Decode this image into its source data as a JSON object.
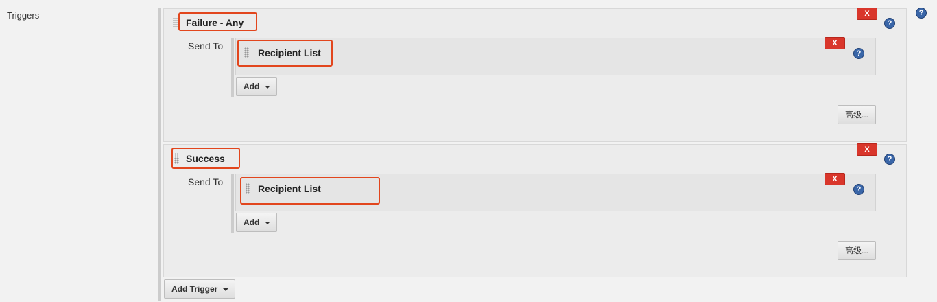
{
  "section": {
    "label": "Triggers"
  },
  "triggers": [
    {
      "title": "Failure - Any",
      "delete_label": "X",
      "send_to_label": "Send To",
      "recipients": [
        {
          "title": "Recipient List",
          "delete_label": "X"
        }
      ],
      "add_label": "Add",
      "advanced_label": "高级..."
    },
    {
      "title": "Success",
      "delete_label": "X",
      "send_to_label": "Send To",
      "recipients": [
        {
          "title": "Recipient List",
          "delete_label": "X"
        }
      ],
      "add_label": "Add",
      "advanced_label": "高级..."
    }
  ],
  "add_trigger_label": "Add Trigger",
  "icons": {
    "help": "help-icon",
    "drag": "drag-handle-icon",
    "dropdown": "caret-down-icon"
  },
  "colors": {
    "delete": "#d9362b",
    "highlight": "#e2461d",
    "help": "#3a66a8"
  }
}
